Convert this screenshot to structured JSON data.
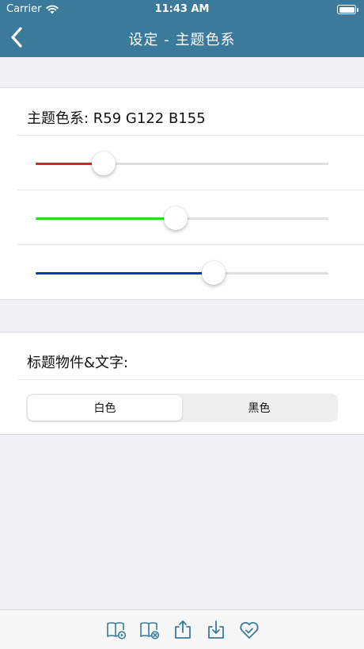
{
  "status_bar": {
    "carrier": "Carrier",
    "time": "11:43 AM"
  },
  "nav": {
    "title": "设定 - 主题色系",
    "back_icon": "chevron-left-icon"
  },
  "theme": {
    "label": "主题色系: R59 G122 B155",
    "sliders": [
      {
        "name": "red",
        "value": 59,
        "max": 255,
        "color": "#e02020"
      },
      {
        "name": "green",
        "value": 122,
        "max": 255,
        "color": "#22dd22"
      },
      {
        "name": "blue",
        "value": 155,
        "max": 255,
        "color": "#1030d0"
      }
    ],
    "accent": "#3b7a9b"
  },
  "title_text": {
    "label": "标题物件&文字:",
    "segments": [
      "白色",
      "黑色"
    ],
    "selected": 0
  },
  "tabbar": {
    "icons": [
      "book-play-icon",
      "book-remove-icon",
      "share-upload-icon",
      "download-icon",
      "heart-check-icon"
    ],
    "color": "#3b7a9b"
  }
}
